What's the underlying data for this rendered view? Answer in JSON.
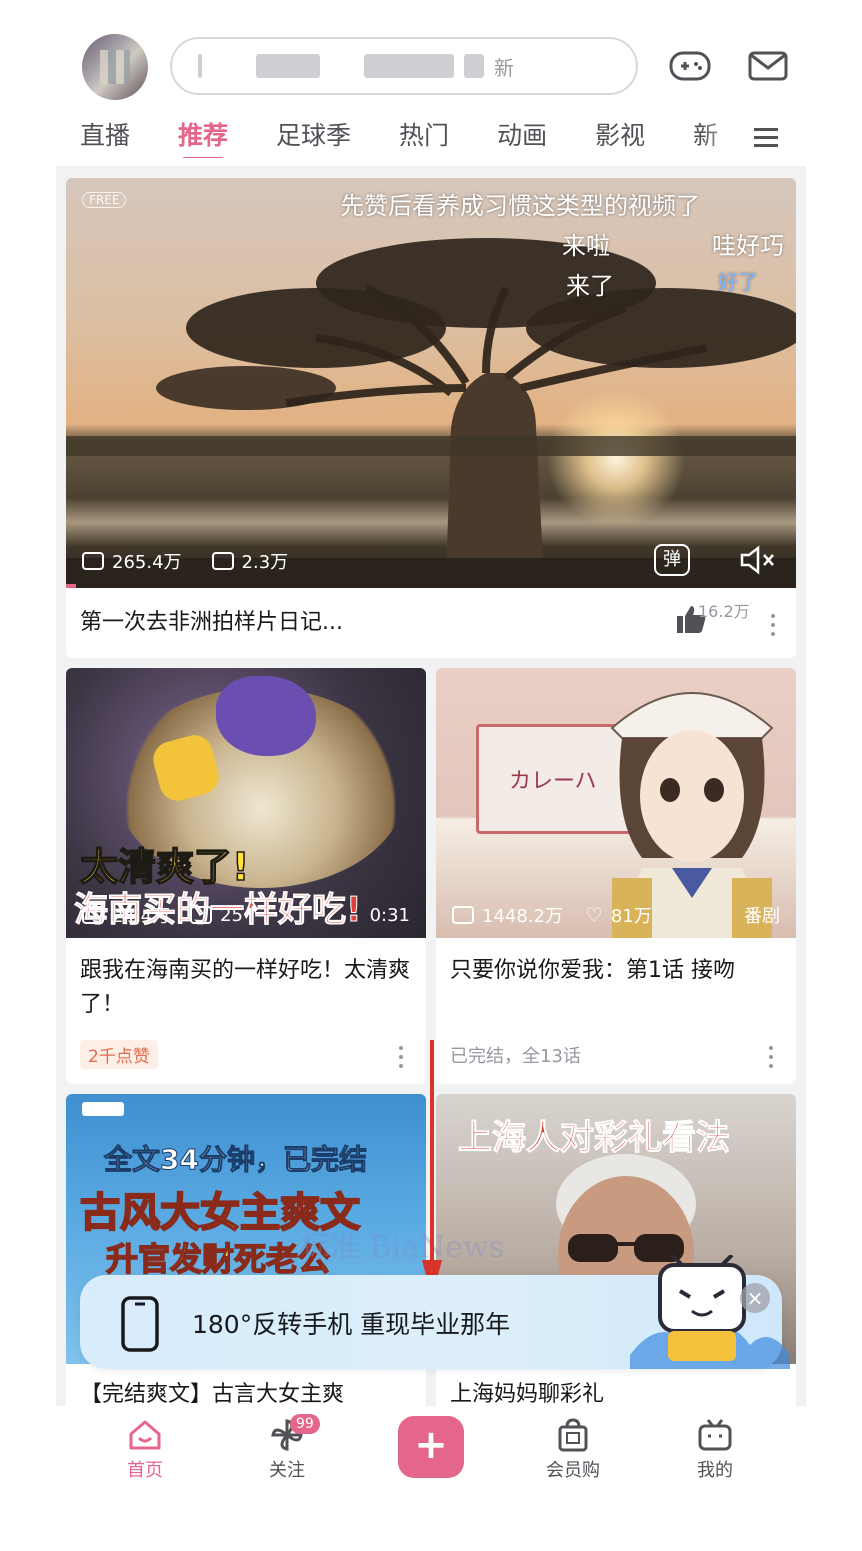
{
  "search": {
    "placeholder_visible": "新"
  },
  "tabs": [
    "直播",
    "推荐",
    "足球季",
    "热门",
    "动画",
    "影视",
    "新"
  ],
  "active_tab_index": 1,
  "hero": {
    "free_badge": "FREE",
    "danmaku": [
      "先赞后看养成习惯这类型的视频了",
      "来啦",
      "哇好巧",
      "来了",
      "好了"
    ],
    "plays": "265.4万",
    "comments": "2.3万",
    "danmaku_toggle": "弹",
    "title": "第一次去非洲拍样片日记...",
    "likes": "16.2万"
  },
  "cards": [
    {
      "overlay_line1": "太清爽了!",
      "overlay_line2": "海南买的一样好吃!",
      "plays": "24.4万",
      "comments": "25",
      "duration": "0:31",
      "title": "跟我在海南买的一样好吃！太清爽了！",
      "tag": "2千点赞"
    },
    {
      "sign": "カレーハ",
      "plays": "1448.2万",
      "likes": "81万",
      "badge": "番剧",
      "title": "只要你说你爱我：第1话 接吻",
      "sub": "已完结，全13话"
    },
    {
      "overlay_line1": "全文34分钟，已完结",
      "overlay_line2": "古风大女主爽文",
      "overlay_line3": "升官发财死老公",
      "title": "【完结爽文】古言大女主爽"
    },
    {
      "overlay_line1": "上海人对彩礼看法",
      "title": "上海妈妈聊彩礼"
    }
  ],
  "watermark": "标准 BiaNews",
  "banner": {
    "text": "180°反转手机 重现毕业那年",
    "close": "×"
  },
  "bottom_nav": {
    "home": "首页",
    "follow": "关注",
    "follow_badge": "99",
    "plus": "+",
    "shop": "会员购",
    "mine": "我的"
  },
  "colors": {
    "accent": "#e5668b",
    "text": "#18191c",
    "secondary": "#9499a0",
    "arrow": "#d9342b"
  }
}
